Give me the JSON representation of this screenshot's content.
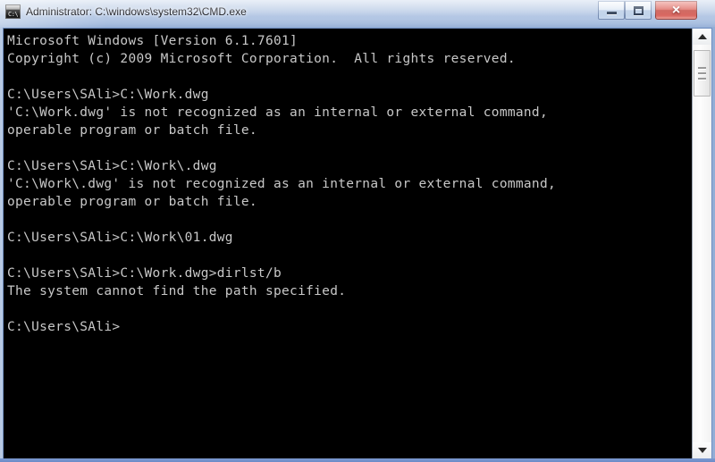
{
  "window": {
    "title": "Administrator: C:\\windows\\system32\\CMD.exe",
    "icon": "cmd-console-icon",
    "icon_glyph": "C:\\",
    "accent_color": "#93aed6",
    "close_button_color": "#c23c33"
  },
  "titlebar": {
    "minimize_label": "Minimize",
    "maximize_label": "Maximize",
    "close_label": "×"
  },
  "console": {
    "background_color": "#000000",
    "text_color": "#c8c8c8",
    "lines": [
      "Microsoft Windows [Version 6.1.7601]",
      "Copyright (c) 2009 Microsoft Corporation.  All rights reserved.",
      "",
      "C:\\Users\\SAli>C:\\Work.dwg",
      "'C:\\Work.dwg' is not recognized as an internal or external command,",
      "operable program or batch file.",
      "",
      "C:\\Users\\SAli>C:\\Work\\.dwg",
      "'C:\\Work\\.dwg' is not recognized as an internal or external command,",
      "operable program or batch file.",
      "",
      "C:\\Users\\SAli>C:\\Work\\01.dwg",
      "",
      "C:\\Users\\SAli>C:\\Work.dwg>dirlst/b",
      "The system cannot find the path specified.",
      "",
      "C:\\Users\\SAli>"
    ],
    "text": "Microsoft Windows [Version 6.1.7601]\nCopyright (c) 2009 Microsoft Corporation.  All rights reserved.\n\nC:\\Users\\SAli>C:\\Work.dwg\n'C:\\Work.dwg' is not recognized as an internal or external command,\noperable program or batch file.\n\nC:\\Users\\SAli>C:\\Work\\.dwg\n'C:\\Work\\.dwg' is not recognized as an internal or external command,\noperable program or batch file.\n\nC:\\Users\\SAli>C:\\Work\\01.dwg\n\nC:\\Users\\SAli>C:\\Work.dwg>dirlst/b\nThe system cannot find the path specified.\n\nC:\\Users\\SAli>"
  },
  "scrollbar": {
    "up_arrow": "scroll-up-arrow",
    "down_arrow": "scroll-down-arrow",
    "thumb": "scroll-thumb"
  }
}
